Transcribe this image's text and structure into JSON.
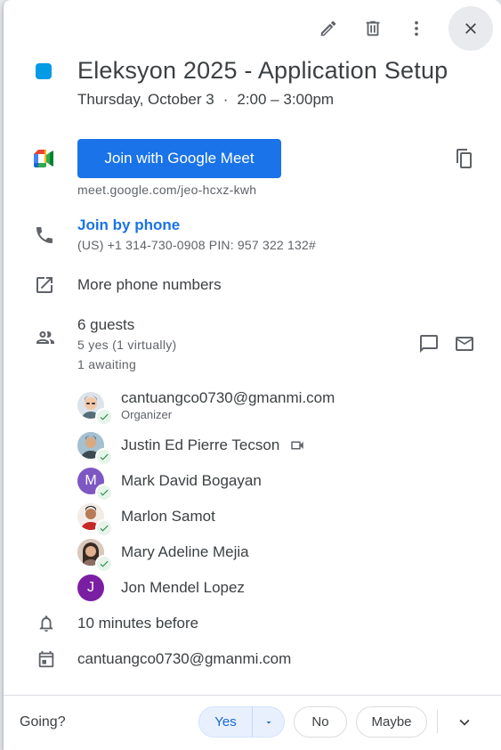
{
  "toolbar": {
    "edit_icon": "pencil-icon",
    "delete_icon": "trash-icon",
    "more_icon": "more-vert-icon",
    "close_icon": "close-icon"
  },
  "event": {
    "color": "#039be5",
    "title": "Eleksyon 2025 - Application Setup",
    "date": "Thursday, October 3",
    "separator": "·",
    "time": "2:00 – 3:00pm"
  },
  "meet": {
    "button_label": "Join with Google Meet",
    "link": "meet.google.com/jeo-hcxz-kwh",
    "copy_icon": "copy-icon"
  },
  "phone": {
    "join_label": "Join by phone",
    "detail": "(US) +1 314-730-0908 PIN: 957 322 132#",
    "more_numbers": "More phone numbers"
  },
  "guests": {
    "count": "6 guests",
    "summary_yes": "5 yes (1 virtually)",
    "summary_awaiting": "1 awaiting",
    "list": [
      {
        "name": "cantuangco0730@gmanmi.com",
        "role": "Organizer",
        "initial": "",
        "color": "#d7d7d7",
        "accepted": true
      },
      {
        "name": "Justin Ed Pierre Tecson",
        "role": "",
        "initial": "",
        "color": "#9fb7c9",
        "accepted": true,
        "virtual": true
      },
      {
        "name": "Mark David Bogayan",
        "role": "",
        "initial": "M",
        "color": "#7e57c2",
        "accepted": true
      },
      {
        "name": "Marlon Samot",
        "role": "",
        "initial": "",
        "color": "#8d6e63",
        "accepted": true
      },
      {
        "name": "Mary Adeline Mejia",
        "role": "",
        "initial": "",
        "color": "#a1887f",
        "accepted": true
      },
      {
        "name": "Jon Mendel Lopez",
        "role": "",
        "initial": "J",
        "color": "#7b1fa2",
        "accepted": false
      }
    ]
  },
  "reminder": "10 minutes before",
  "calendar_owner": "cantuangco0730@gmanmi.com",
  "rsvp": {
    "prompt": "Going?",
    "yes": "Yes",
    "no": "No",
    "maybe": "Maybe"
  }
}
